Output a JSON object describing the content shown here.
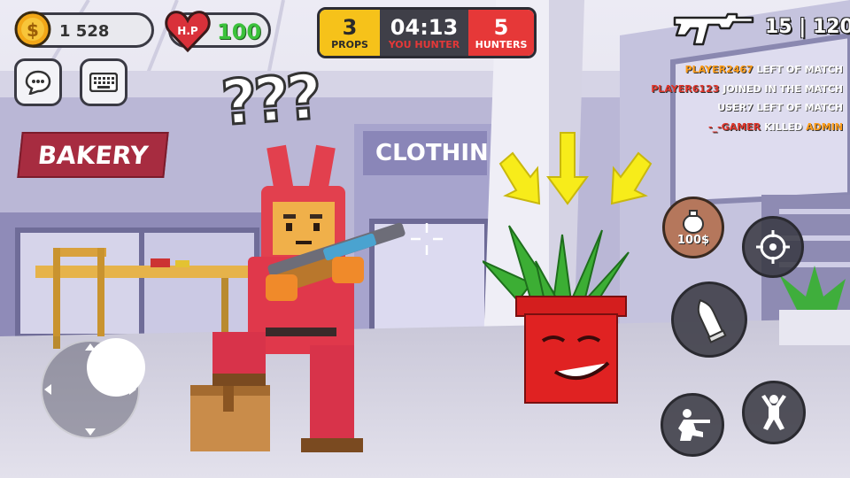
{
  "hud": {
    "coins": "1 528",
    "hp_label": "H.P",
    "hp_value": "100",
    "ammo": "15 | 120"
  },
  "scoreboard": {
    "props_count": "3",
    "props_label": "PROPS",
    "timer": "04:13",
    "role_label": "YOU HUNTER",
    "hunters_count": "5",
    "hunters_label": "HUNTERS"
  },
  "kill_feed": [
    {
      "player": "PLAYER2467",
      "player_color": "#ff9e1b",
      "action": "LEFT OF MATCH",
      "target": "",
      "target_color": ""
    },
    {
      "player": "PLAYER6123",
      "player_color": "#e0362c",
      "action": "JOINED IN THE MATCH",
      "target": "",
      "target_color": ""
    },
    {
      "player": "USER7",
      "player_color": "#ffffff",
      "action": "LEFT OF MATCH",
      "target": "",
      "target_color": ""
    },
    {
      "player": "-_-GAMER",
      "player_color": "#e0362c",
      "action": "KILLED",
      "target": "ADMIN",
      "target_color": "#ff9e1b"
    }
  ],
  "store_signs": {
    "bakery": "BAKERY",
    "clothing": "CLOTHING"
  },
  "decoy_button": {
    "price": "100$"
  },
  "overlay_text": {
    "question_marks": "???"
  },
  "colors": {
    "props_bg": "#f6c21a",
    "timer_bg": "#3f3f48",
    "hunters_bg": "#e63838",
    "hp_green": "#3bc13b",
    "role_red": "#e63838"
  },
  "icons": [
    "coin-icon",
    "heart-icon",
    "chat-icon",
    "keyboard-icon",
    "rifle-icon",
    "crosshair-icon",
    "grenade-icon",
    "target-icon",
    "fire-bullet-icon",
    "crouch-shoot-icon",
    "jump-icon",
    "joystick-icon"
  ]
}
